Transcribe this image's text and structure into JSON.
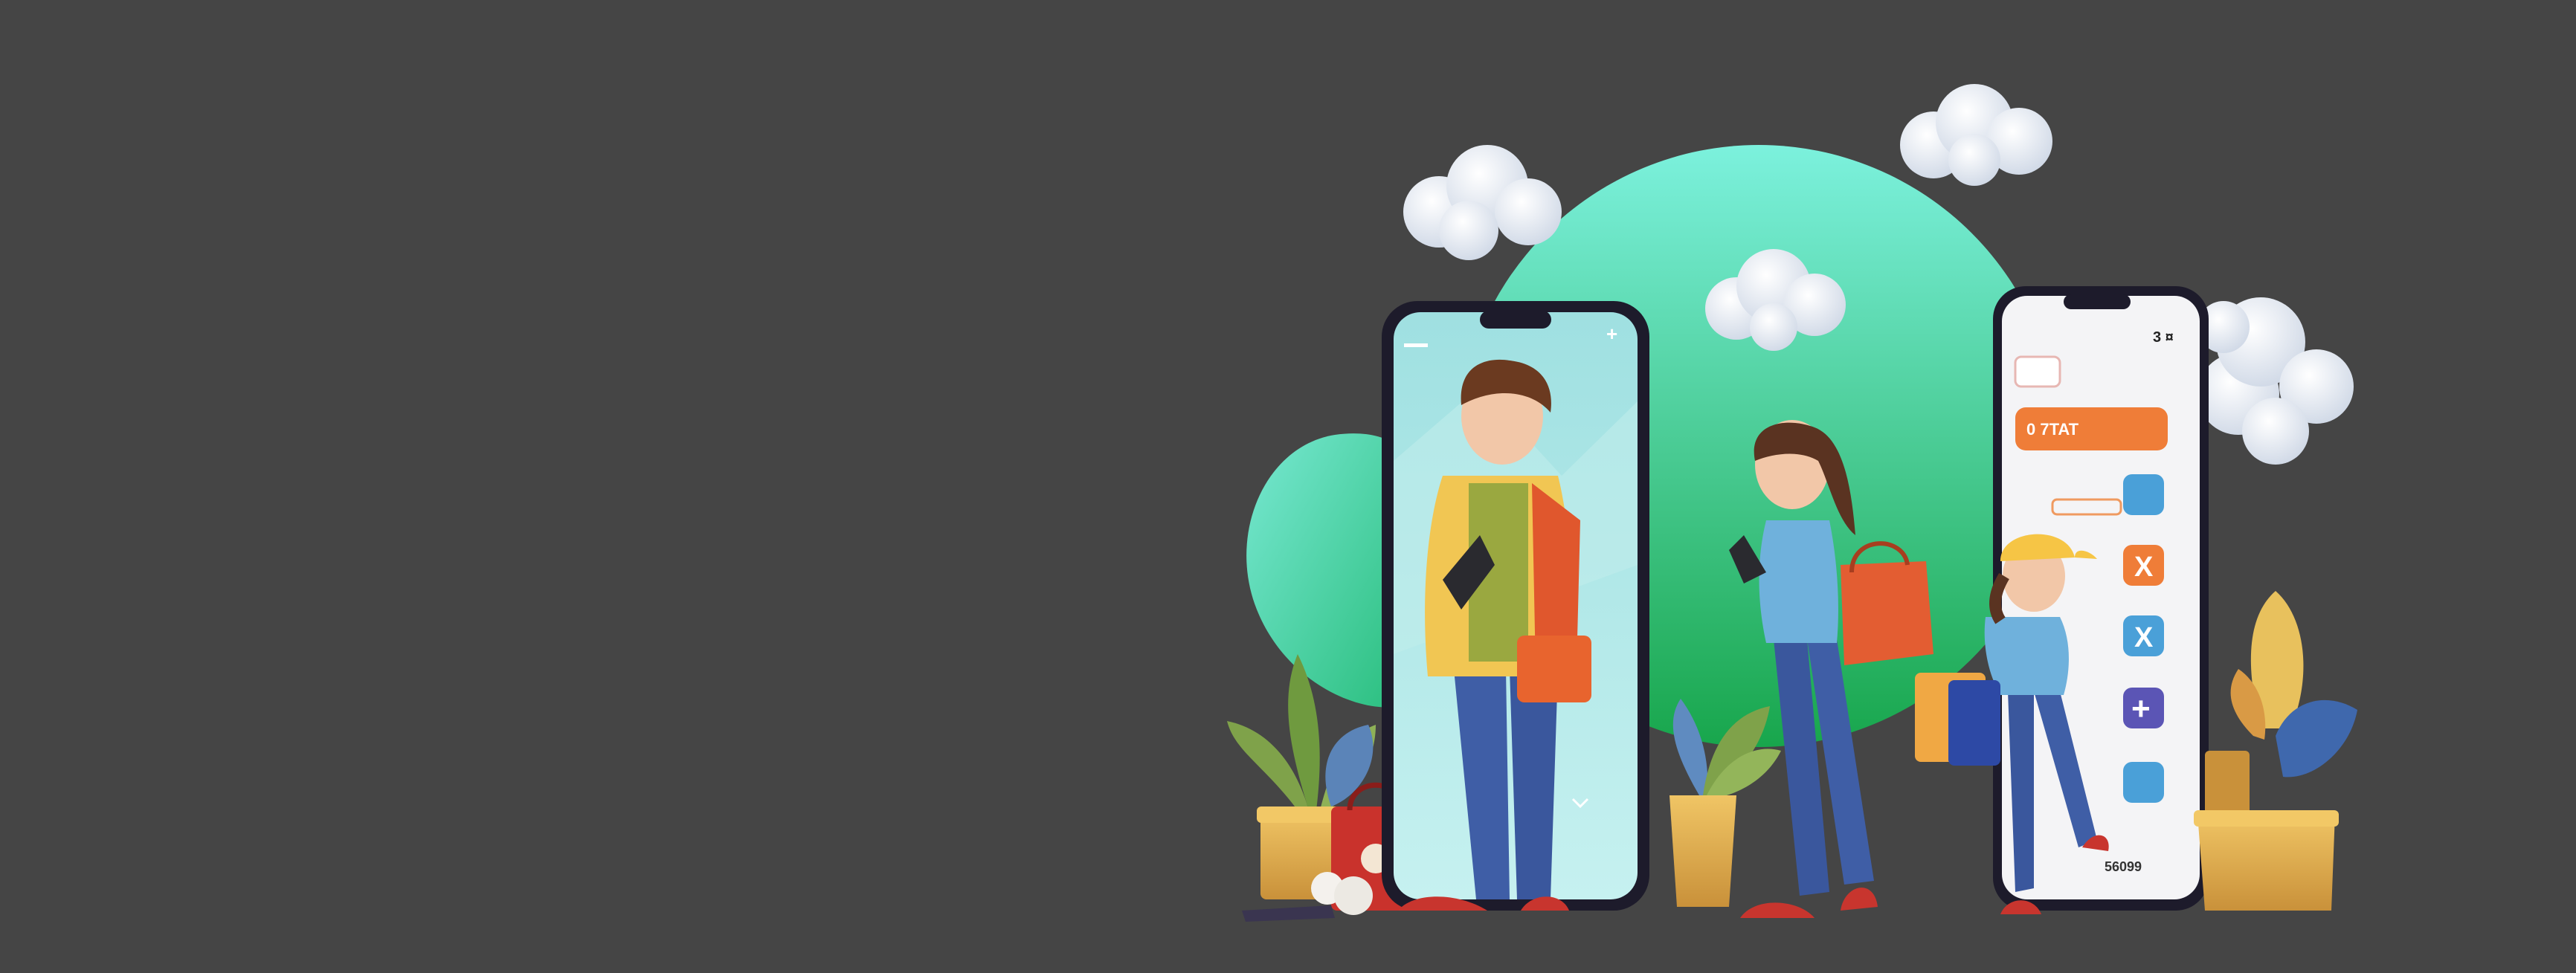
{
  "colors": {
    "background": "#454545",
    "green_top": "#7cf1dd",
    "green_bottom": "#18a64c",
    "phone_frame": "#1d1b2b",
    "accent_orange": "#ef7d38",
    "app_blue": "#4aa0d8",
    "app_purple": "#5b55b5",
    "pot": "#e3b14f"
  },
  "phones": {
    "left": {
      "screen_color": "#a8e3e2"
    },
    "right": {
      "screen_color": "#f4f4f6",
      "banner_text": "0 7TAT",
      "time_text": "3 ¤",
      "price_text": "56099",
      "icons": [
        "square-icon",
        "cross-icon",
        "x-icon",
        "plus-icon",
        "bird-icon"
      ]
    }
  }
}
